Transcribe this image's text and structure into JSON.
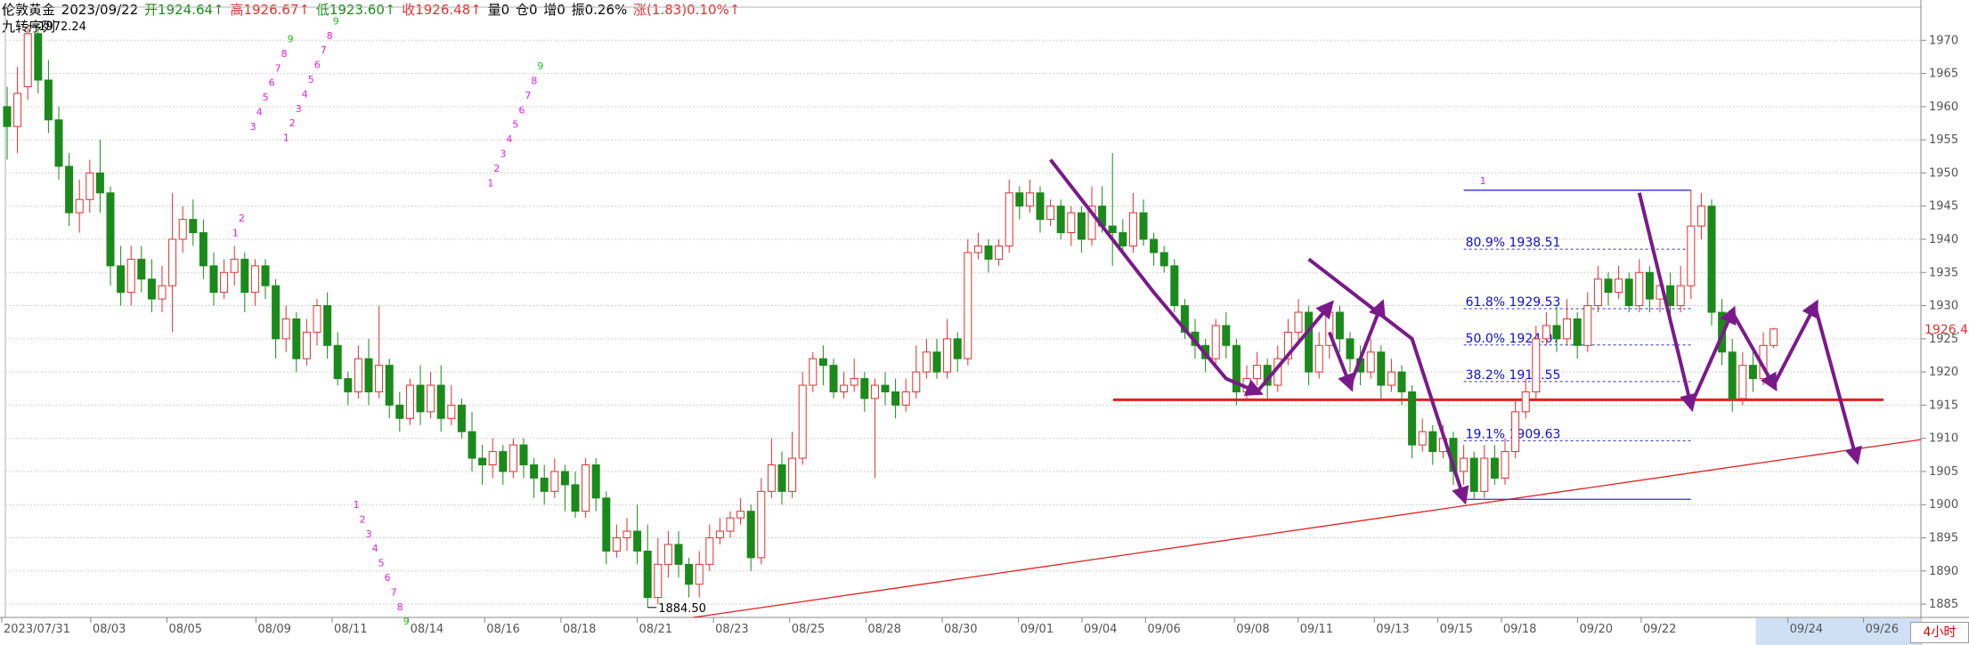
{
  "header": {
    "symbol": "伦敦黄金",
    "date": "2023/09/22",
    "open": "开1924.64↑",
    "high": "高1926.67↑",
    "low": "低1923.60↑",
    "close": "收1926.48↑",
    "volume": "量0",
    "position": "仓0",
    "increase": "增0",
    "amplitude": "振0.26%",
    "change": "涨(1.83)0.10%↑"
  },
  "indicator_name": "九转序列",
  "period_label": "4小时",
  "current_price": "1926.48",
  "colors": {
    "up": "#e03030",
    "down": "#1a8a1a",
    "seq_magenta": "#e020e0",
    "seq_green": "#20c020",
    "fib_line": "#3030d0",
    "support_line": "#e02020",
    "arrow": "#7a1a8a",
    "grid": "#d0d0d0"
  },
  "chart_data": {
    "type": "candlestick",
    "ylim": [
      1883,
      1975
    ],
    "y_ticks": [
      1885,
      1890,
      1895,
      1900,
      1905,
      1910,
      1915,
      1920,
      1925,
      1930,
      1935,
      1940,
      1945,
      1950,
      1955,
      1960,
      1965,
      1970
    ],
    "x_labels": [
      "2023/07/31",
      "08/03",
      "08/05",
      "08/09",
      "08/11",
      "08/14",
      "08/16",
      "08/18",
      "08/21",
      "08/23",
      "08/25",
      "08/28",
      "08/30",
      "09/01",
      "09/04",
      "09/06",
      "09/08",
      "09/11",
      "09/13",
      "09/15",
      "09/18",
      "09/20",
      "09/22",
      "09/24",
      "09/26"
    ],
    "future_labels": [
      "09/24",
      "09/26"
    ],
    "max_annotation": "1972.24",
    "min_annotation": "1884.50",
    "fib_levels": [
      {
        "label": "80.9% 1938.51",
        "value": 1938.51
      },
      {
        "label": "61.8% 1929.53",
        "value": 1929.53
      },
      {
        "label": "50.0% 1924.07",
        "value": 1924.07
      },
      {
        "label": "38.2% 1918.55",
        "value": 1918.55
      },
      {
        "label": "19.1% 1909.63",
        "value": 1909.63
      }
    ],
    "fib_top": 1947.4,
    "fib_bottom": 1900.8,
    "fib_top_label": "1",
    "support_level": 1915.8,
    "trendline": {
      "from": [
        13.5,
        1883
      ],
      "to": [
        63.8,
        1909.8
      ]
    },
    "sequence_groups": [
      {
        "x": 21.8,
        "base": 1940.5,
        "labels": [
          "1",
          "2"
        ],
        "colors": [
          "m",
          "m"
        ]
      },
      {
        "x": 23.5,
        "base": 1956.5,
        "labels": [
          "3",
          "4",
          "5",
          "6",
          "7",
          "8",
          "9"
        ],
        "colors": [
          "m",
          "m",
          "m",
          "m",
          "m",
          "m",
          "g"
        ]
      },
      {
        "x": 26.7,
        "base": 1954.8,
        "labels": [
          "1",
          "2",
          "3",
          "4",
          "5",
          "6",
          "7",
          "8",
          "9"
        ],
        "colors": [
          "m",
          "m",
          "m",
          "m",
          "m",
          "m",
          "m",
          "m",
          "g"
        ]
      },
      {
        "x": 33.5,
        "base": 1899.5,
        "labels": [
          "1",
          "2",
          "3",
          "4",
          "5",
          "6",
          "7",
          "8",
          "9"
        ],
        "colors": [
          "m",
          "m",
          "m",
          "m",
          "m",
          "m",
          "m",
          "m",
          "g"
        ]
      },
      {
        "x": 46.5,
        "base": 1948.0,
        "labels": [
          "1",
          "2",
          "3",
          "4",
          "5",
          "6",
          "7",
          "8",
          "9"
        ],
        "colors": [
          "m",
          "m",
          "m",
          "m",
          "m",
          "m",
          "m",
          "m",
          "g"
        ]
      }
    ],
    "candles": [
      [
        1960,
        1957,
        1963,
        1952
      ],
      [
        1957,
        1962,
        1966,
        1953
      ],
      [
        1963,
        1971,
        1972.2,
        1961
      ],
      [
        1971,
        1964,
        1972,
        1962
      ],
      [
        1964,
        1958,
        1967,
        1956
      ],
      [
        1958,
        1951,
        1960,
        1949
      ],
      [
        1951,
        1944,
        1953,
        1942
      ],
      [
        1944,
        1946,
        1949,
        1941
      ],
      [
        1946,
        1950,
        1952,
        1944
      ],
      [
        1950,
        1947,
        1955,
        1944
      ],
      [
        1947,
        1936,
        1948,
        1933
      ],
      [
        1936,
        1932,
        1939,
        1930
      ],
      [
        1932,
        1937,
        1939,
        1930
      ],
      [
        1937,
        1934,
        1939,
        1932
      ],
      [
        1934,
        1931,
        1937,
        1929
      ],
      [
        1931,
        1933,
        1936,
        1929
      ],
      [
        1933,
        1940,
        1947,
        1926
      ],
      [
        1940,
        1943,
        1945,
        1938
      ],
      [
        1943,
        1941,
        1946,
        1939
      ],
      [
        1941,
        1936,
        1943,
        1934
      ],
      [
        1936,
        1932,
        1938,
        1930
      ],
      [
        1932,
        1935,
        1937,
        1931
      ],
      [
        1935,
        1937,
        1939,
        1933
      ],
      [
        1937,
        1932,
        1938,
        1929
      ],
      [
        1932,
        1936,
        1937,
        1930
      ],
      [
        1936,
        1933,
        1937,
        1931
      ],
      [
        1933,
        1925,
        1934,
        1922
      ],
      [
        1925,
        1928,
        1930,
        1923
      ],
      [
        1928,
        1922,
        1929,
        1920
      ],
      [
        1922,
        1926,
        1928,
        1921
      ],
      [
        1926,
        1930,
        1931,
        1924
      ],
      [
        1930,
        1924,
        1932,
        1922
      ],
      [
        1924,
        1919,
        1926,
        1918
      ],
      [
        1919,
        1917,
        1920,
        1915
      ],
      [
        1917,
        1922,
        1924,
        1916
      ],
      [
        1922,
        1917,
        1925,
        1915
      ],
      [
        1917,
        1921,
        1930,
        1916
      ],
      [
        1921,
        1915,
        1922,
        1913
      ],
      [
        1915,
        1913,
        1917,
        1911
      ],
      [
        1913,
        1918,
        1919,
        1912
      ],
      [
        1918,
        1914,
        1921,
        1912
      ],
      [
        1914,
        1918,
        1920,
        1913
      ],
      [
        1918,
        1913,
        1921,
        1911
      ],
      [
        1913,
        1915,
        1918,
        1912
      ],
      [
        1915,
        1911,
        1916,
        1910
      ],
      [
        1911,
        1907,
        1914,
        1905
      ],
      [
        1907,
        1906,
        1909,
        1903
      ],
      [
        1906,
        1908,
        1910,
        1904
      ],
      [
        1908,
        1905,
        1909,
        1903
      ],
      [
        1905,
        1909,
        1910,
        1904
      ],
      [
        1909,
        1906,
        1910,
        1904
      ],
      [
        1906,
        1904,
        1907,
        1901
      ],
      [
        1904,
        1902,
        1906,
        1900
      ],
      [
        1902,
        1905,
        1907,
        1901
      ],
      [
        1905,
        1903,
        1906,
        1899
      ],
      [
        1903,
        1899,
        1905,
        1898
      ],
      [
        1899,
        1906,
        1907,
        1898
      ],
      [
        1906,
        1901,
        1907,
        1899
      ],
      [
        1901,
        1893,
        1902,
        1891
      ],
      [
        1893,
        1895,
        1897,
        1892
      ],
      [
        1895,
        1896,
        1898,
        1893
      ],
      [
        1896,
        1893,
        1900,
        1891
      ],
      [
        1893,
        1886,
        1897,
        1884.5
      ],
      [
        1886,
        1891,
        1895,
        1885
      ],
      [
        1891,
        1894,
        1896,
        1889
      ],
      [
        1894,
        1891,
        1896,
        1889
      ],
      [
        1891,
        1888,
        1892,
        1886
      ],
      [
        1888,
        1891,
        1893,
        1886
      ],
      [
        1891,
        1895,
        1897,
        1890
      ],
      [
        1895,
        1896,
        1898,
        1894
      ],
      [
        1896,
        1898,
        1899,
        1895
      ],
      [
        1898,
        1899,
        1901,
        1897
      ],
      [
        1899,
        1892,
        1900,
        1890
      ],
      [
        1892,
        1902,
        1904,
        1891
      ],
      [
        1902,
        1906,
        1910,
        1901
      ],
      [
        1906,
        1902,
        1908,
        1900
      ],
      [
        1902,
        1907,
        1911,
        1901
      ],
      [
        1907,
        1918,
        1920,
        1906
      ],
      [
        1918,
        1922,
        1923,
        1917
      ],
      [
        1922,
        1921,
        1924,
        1918
      ],
      [
        1921,
        1917,
        1922,
        1916
      ],
      [
        1917,
        1918,
        1920,
        1916
      ],
      [
        1918,
        1919,
        1922,
        1917
      ],
      [
        1919,
        1916,
        1920,
        1914
      ],
      [
        1916,
        1918,
        1919,
        1904
      ],
      [
        1918,
        1917,
        1920,
        1915
      ],
      [
        1917,
        1915,
        1919,
        1913
      ],
      [
        1915,
        1917,
        1919,
        1914
      ],
      [
        1917,
        1920,
        1924,
        1916
      ],
      [
        1920,
        1923,
        1925,
        1919
      ],
      [
        1923,
        1920,
        1925,
        1919
      ],
      [
        1920,
        1925,
        1928,
        1919
      ],
      [
        1925,
        1922,
        1926,
        1920
      ],
      [
        1922,
        1938,
        1940,
        1921
      ],
      [
        1938,
        1939,
        1941,
        1937
      ],
      [
        1939,
        1937,
        1940,
        1935
      ],
      [
        1937,
        1939,
        1940,
        1936
      ],
      [
        1939,
        1947,
        1949,
        1938
      ],
      [
        1947,
        1945,
        1948,
        1943
      ],
      [
        1945,
        1947,
        1949,
        1944
      ],
      [
        1947,
        1943,
        1948,
        1941
      ],
      [
        1943,
        1945,
        1946,
        1942
      ],
      [
        1945,
        1941,
        1946,
        1940
      ],
      [
        1941,
        1944,
        1945,
        1939
      ],
      [
        1944,
        1940,
        1945,
        1938
      ],
      [
        1940,
        1945,
        1948,
        1939
      ],
      [
        1945,
        1942,
        1948,
        1941
      ],
      [
        1942,
        1941,
        1953,
        1936
      ],
      [
        1941,
        1939,
        1943,
        1938
      ],
      [
        1939,
        1944,
        1947,
        1938
      ],
      [
        1944,
        1940,
        1946,
        1939
      ],
      [
        1940,
        1938,
        1941,
        1936
      ],
      [
        1938,
        1936,
        1939,
        1935
      ],
      [
        1936,
        1930,
        1937,
        1929
      ],
      [
        1930,
        1926,
        1931,
        1925
      ],
      [
        1926,
        1924,
        1928,
        1922
      ],
      [
        1924,
        1922,
        1925,
        1920
      ],
      [
        1922,
        1927,
        1928,
        1921
      ],
      [
        1927,
        1924,
        1929,
        1922
      ],
      [
        1924,
        1917,
        1925,
        1915
      ],
      [
        1917,
        1919,
        1921,
        1916
      ],
      [
        1919,
        1921,
        1923,
        1918
      ],
      [
        1921,
        1918,
        1922,
        1916
      ],
      [
        1918,
        1922,
        1924,
        1917
      ],
      [
        1922,
        1926,
        1928,
        1921
      ],
      [
        1926,
        1929,
        1931,
        1924
      ],
      [
        1929,
        1920,
        1930,
        1918
      ],
      [
        1920,
        1924,
        1926,
        1919
      ],
      [
        1924,
        1929,
        1930,
        1922
      ],
      [
        1929,
        1925,
        1930,
        1923
      ],
      [
        1925,
        1922,
        1926,
        1920
      ],
      [
        1922,
        1920,
        1924,
        1918
      ],
      [
        1920,
        1923,
        1925,
        1919
      ],
      [
        1923,
        1918,
        1924,
        1916
      ],
      [
        1918,
        1920,
        1922,
        1917
      ],
      [
        1920,
        1917,
        1921,
        1915
      ],
      [
        1917,
        1909,
        1918,
        1907
      ],
      [
        1909,
        1911,
        1913,
        1908
      ],
      [
        1911,
        1908,
        1912,
        1906
      ],
      [
        1908,
        1910,
        1912,
        1907
      ],
      [
        1910,
        1905,
        1911,
        1903
      ],
      [
        1905,
        1907,
        1909,
        1903
      ],
      [
        1907,
        1902,
        1908,
        1900.8
      ],
      [
        1902,
        1907,
        1909,
        1901
      ],
      [
        1907,
        1904,
        1909,
        1903
      ],
      [
        1904,
        1908,
        1910,
        1903
      ],
      [
        1908,
        1914,
        1916,
        1907
      ],
      [
        1914,
        1917,
        1919,
        1913
      ],
      [
        1917,
        1925,
        1927,
        1916
      ],
      [
        1925,
        1927,
        1929,
        1924
      ],
      [
        1927,
        1925,
        1930,
        1923
      ],
      [
        1925,
        1928,
        1931,
        1924
      ],
      [
        1928,
        1924,
        1929,
        1922
      ],
      [
        1924,
        1930,
        1932,
        1923
      ],
      [
        1930,
        1934,
        1936,
        1929
      ],
      [
        1934,
        1932,
        1935,
        1930
      ],
      [
        1932,
        1934,
        1936,
        1931
      ],
      [
        1934,
        1930,
        1935,
        1929
      ],
      [
        1930,
        1935,
        1937,
        1929
      ],
      [
        1935,
        1931,
        1936,
        1929
      ],
      [
        1931,
        1933,
        1934,
        1929
      ],
      [
        1933,
        1930,
        1935,
        1928
      ],
      [
        1930,
        1933,
        1936,
        1929
      ],
      [
        1933,
        1942,
        1947.4,
        1931
      ],
      [
        1942,
        1945,
        1947,
        1940
      ],
      [
        1945,
        1929,
        1946,
        1927
      ],
      [
        1929,
        1923,
        1931,
        1921
      ],
      [
        1923,
        1916,
        1925,
        1914
      ],
      [
        1916,
        1921,
        1923,
        1915
      ],
      [
        1921,
        1919,
        1923,
        1917
      ],
      [
        1919,
        1924,
        1926,
        1918
      ],
      [
        1924,
        1926.48,
        1926.67,
        1923.6
      ]
    ]
  }
}
